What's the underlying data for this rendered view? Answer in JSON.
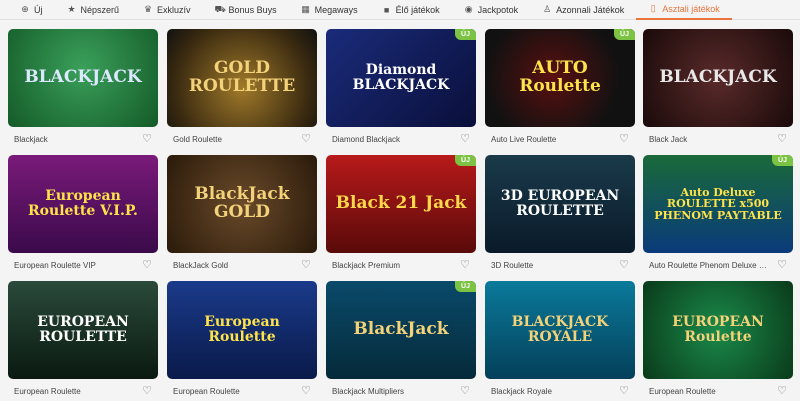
{
  "nav": {
    "tabs": [
      {
        "label": "Új",
        "icon": "plus-icon",
        "glyph": "⊕",
        "active": false
      },
      {
        "label": "Népszerű",
        "icon": "star-icon",
        "glyph": "★",
        "active": false
      },
      {
        "label": "Exkluzív",
        "icon": "crown-icon",
        "glyph": "♛",
        "active": false
      },
      {
        "label": "Bonus Buys",
        "icon": "cart-icon",
        "glyph": "⛟",
        "active": false
      },
      {
        "label": "Megaways",
        "icon": "grid-icon",
        "glyph": "▦",
        "active": false
      },
      {
        "label": "Élő játékok",
        "icon": "camera-icon",
        "glyph": "■",
        "active": false
      },
      {
        "label": "Jackpotok",
        "icon": "coin-icon",
        "glyph": "◉",
        "active": false
      },
      {
        "label": "Azonnali Játékok",
        "icon": "person-icon",
        "glyph": "♙",
        "active": false
      },
      {
        "label": "Asztali játékok",
        "icon": "cards-icon",
        "glyph": "▯",
        "active": true
      }
    ]
  },
  "badge_label": "ÚJ",
  "games": [
    {
      "name": "Blackjack",
      "art": "BLACKJACK",
      "bg": "bg-bj1",
      "color": "#dce8ff",
      "new": false
    },
    {
      "name": "Gold Roulette",
      "art": "GOLD ROULETTE",
      "bg": "bg-gold",
      "color": "#f3d27a",
      "new": false
    },
    {
      "name": "Diamond Blackjack",
      "art": "Diamond BLACKJACK",
      "bg": "bg-dia",
      "color": "#ffffff",
      "new": true
    },
    {
      "name": "Auto Live Roulette",
      "art": "AUTO Roulette",
      "bg": "bg-auto",
      "color": "#ffe34a",
      "new": true
    },
    {
      "name": "Black Jack",
      "art": "BLACKJACK",
      "bg": "bg-bj2",
      "color": "#e8e8e8",
      "new": false
    },
    {
      "name": "European Roulette VIP",
      "art": "European Roulette V.I.P.",
      "bg": "bg-erv",
      "color": "#ffe34a",
      "new": false
    },
    {
      "name": "BlackJack Gold",
      "art": "BlackJack GOLD",
      "bg": "bg-bjg",
      "color": "#f3d27a",
      "new": false
    },
    {
      "name": "Blackjack Premium",
      "art": "Black 21 Jack",
      "bg": "bg-bjp",
      "color": "#ffd94a",
      "new": true
    },
    {
      "name": "3D Roulette",
      "art": "3D EUROPEAN ROULETTE",
      "bg": "bg-3d",
      "color": "#ffffff",
      "new": false
    },
    {
      "name": "Auto Roulette Phenom Deluxe Paytable",
      "art": "Auto Deluxe ROULETTE x500 PHENOM PAYTABLE",
      "bg": "bg-arp",
      "color": "#ffe34a",
      "new": true
    },
    {
      "name": "European Roulette",
      "art": "EUROPEAN ROULETTE",
      "bg": "bg-er",
      "color": "#ffffff",
      "new": false
    },
    {
      "name": "European Roulette",
      "art": "European Roulette",
      "bg": "bg-er2",
      "color": "#ffe34a",
      "new": false
    },
    {
      "name": "Blackjack Multipliers",
      "art": "BlackJack",
      "bg": "bg-bjm",
      "color": "#f3d27a",
      "new": true
    },
    {
      "name": "Blackjack Royale",
      "art": "BLACKJACK ROYALE",
      "bg": "bg-bjr",
      "color": "#f3d27a",
      "new": false
    },
    {
      "name": "European Roulette",
      "art": "EUROPEAN Roulette",
      "bg": "bg-er3",
      "color": "#f3d27a",
      "new": false
    }
  ]
}
